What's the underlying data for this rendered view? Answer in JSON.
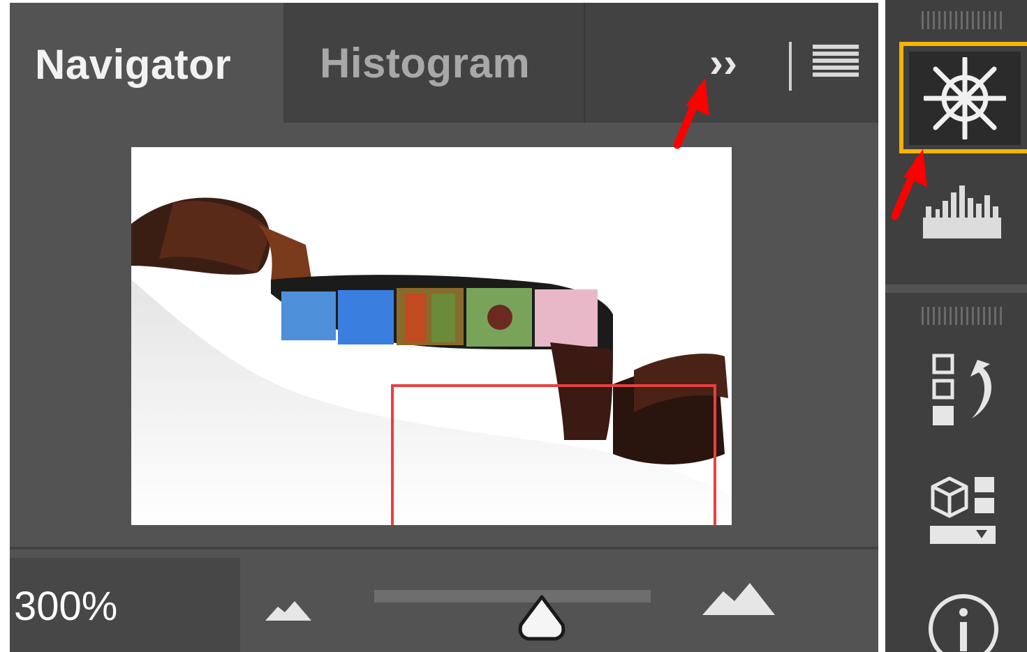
{
  "tabs": [
    {
      "label": "Navigator",
      "active": true
    },
    {
      "label": "Histogram",
      "active": false
    }
  ],
  "toolbar": {
    "more_label": "››",
    "menu_icon": "hamburger-menu-icon"
  },
  "navigator": {
    "preview_description": "film strip photo thumbnail",
    "zoom_value": "300%",
    "zoom_slider_position": 0.62
  },
  "dock": {
    "items": [
      {
        "name": "navigator-panel-icon",
        "selected": true
      },
      {
        "name": "histogram-panel-icon",
        "selected": false
      },
      {
        "name": "history-panel-icon",
        "selected": false
      },
      {
        "name": "3d-panel-icon",
        "selected": false
      },
      {
        "name": "info-panel-icon",
        "selected": false
      }
    ]
  },
  "colors": {
    "panel_bg": "#535353",
    "tab_strip_bg": "#424242",
    "dock_bg": "#3f3f3f",
    "highlight": "#f5b400",
    "view_box": "#e84040",
    "annotation_arrow": "#ff0000"
  }
}
